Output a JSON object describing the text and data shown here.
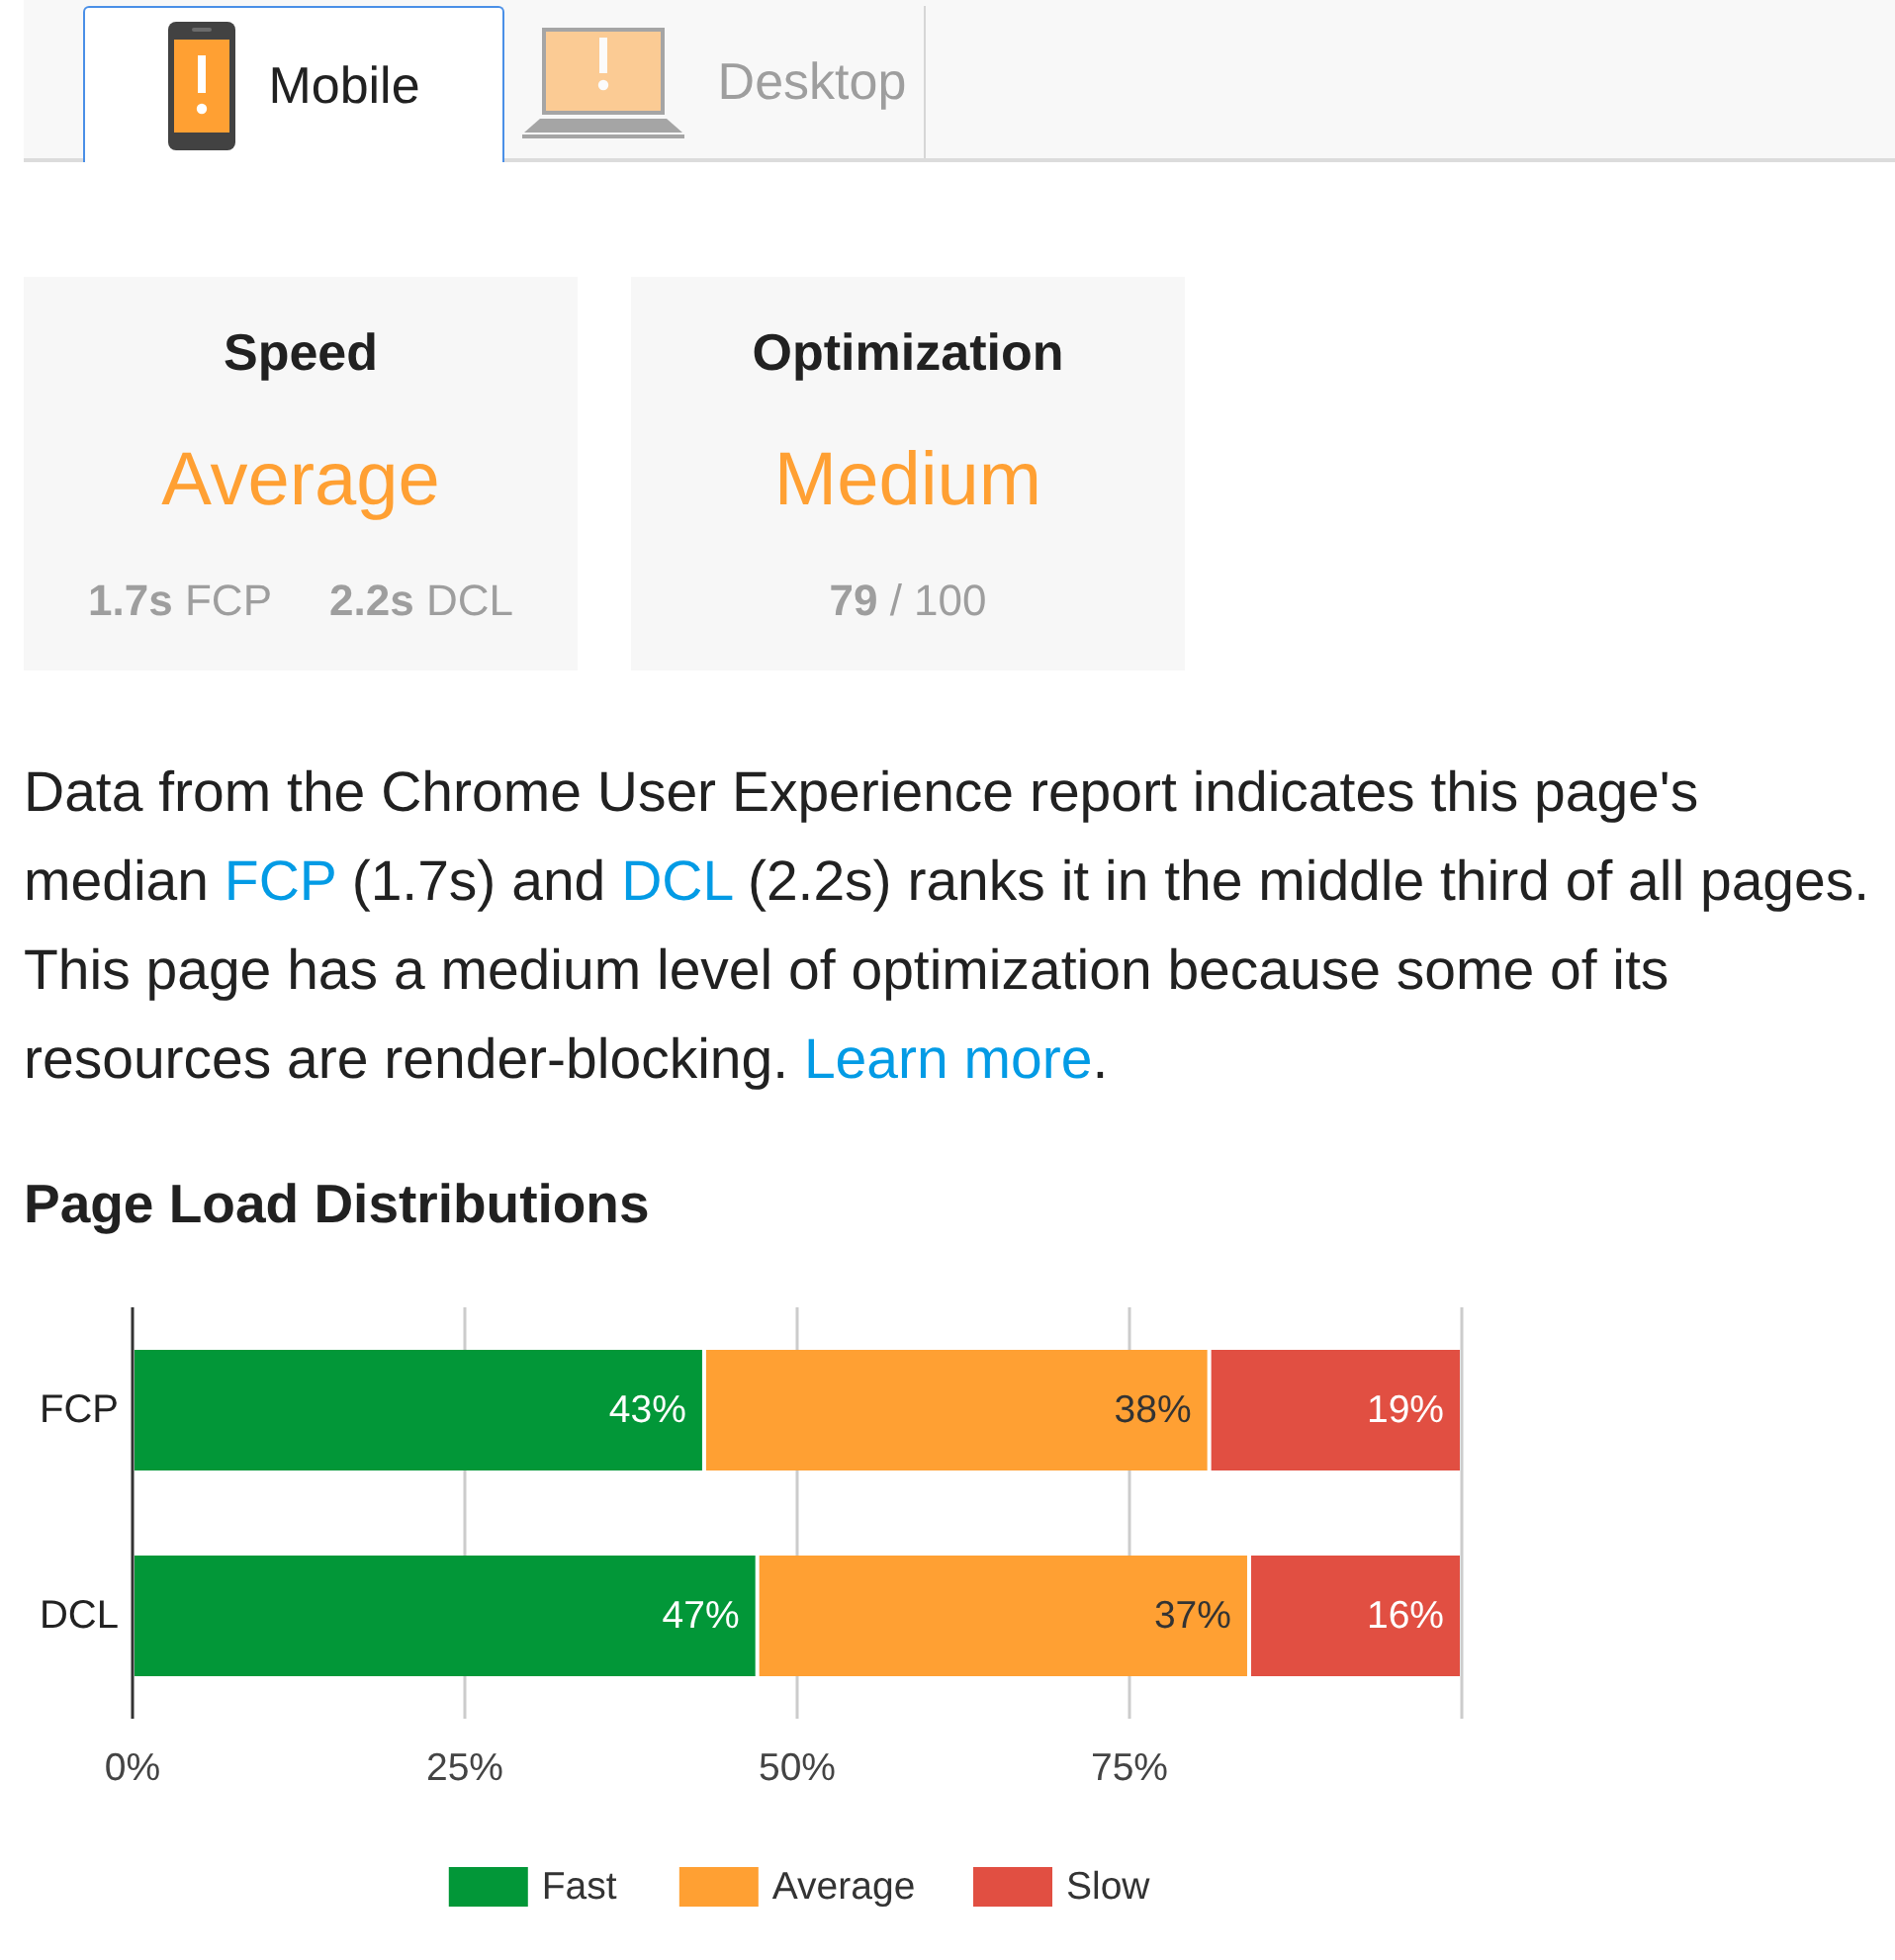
{
  "tabs": [
    {
      "label": "Mobile",
      "kind": "phone",
      "selected": true
    },
    {
      "label": "Desktop",
      "kind": "laptop",
      "selected": false
    }
  ],
  "cards": [
    {
      "title": "Speed",
      "rating": "Average",
      "metrics": [
        "**1.7s** FCP",
        "**2.2s** DCL"
      ]
    },
    {
      "title": "Optimization",
      "rating": "Medium",
      "metrics": [
        "**79** / 100"
      ]
    }
  ],
  "description": [
    {
      "kind": "text",
      "text": "Data from the Chrome User Experience report indicates this page's median "
    },
    {
      "kind": "link",
      "text": "FCP"
    },
    {
      "kind": "text",
      "text": " (1.7s) and "
    },
    {
      "kind": "link",
      "text": "DCL"
    },
    {
      "kind": "text",
      "text": " (2.2s) ranks it in the middle third of all pages. This page has a medium level of optimization because some of its resources are render-blocking. "
    },
    {
      "kind": "link",
      "text": "Learn more"
    },
    {
      "kind": "text",
      "text": "."
    }
  ],
  "distribution": {
    "chart_data": {
      "type": "bar",
      "title": "Page Load Distributions",
      "orientation": "horizontal",
      "stacked": true,
      "categories": [
        "FCP",
        "DCL"
      ],
      "series": [
        {
          "name": "Fast",
          "color": "#029738",
          "values": [
            43,
            47
          ]
        },
        {
          "name": "Average",
          "color": "#ffa033",
          "values": [
            38,
            37
          ]
        },
        {
          "name": "Slow",
          "color": "#e14f42",
          "values": [
            19,
            16
          ]
        }
      ],
      "xlim": [
        0,
        100
      ],
      "xticks": [
        {
          "value": 0,
          "label": "0%"
        },
        {
          "value": 25,
          "label": "25%"
        },
        {
          "value": 50,
          "label": "50%"
        },
        {
          "value": 75,
          "label": "75%"
        }
      ],
      "grid": true,
      "legend": "bottom",
      "value_labels": [
        [
          "43%",
          "47%"
        ],
        [
          "38%",
          "37%"
        ],
        [
          "19%",
          "16%"
        ]
      ]
    }
  }
}
